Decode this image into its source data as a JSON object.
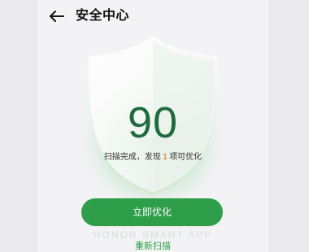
{
  "header": {
    "title": "安全中心",
    "back_icon": "arrow-left-icon"
  },
  "scan": {
    "score": "90",
    "summary_prefix": "扫描完成，发现",
    "issue_count": "1",
    "summary_suffix": "项可优化"
  },
  "actions": {
    "optimize_label": "立即优化",
    "rescan_label": "重新扫描"
  },
  "watermark": "HONOR SMART APP",
  "colors": {
    "accent": "#2f9e4a",
    "score": "#1f6b3d",
    "highlight": "#e07020"
  }
}
